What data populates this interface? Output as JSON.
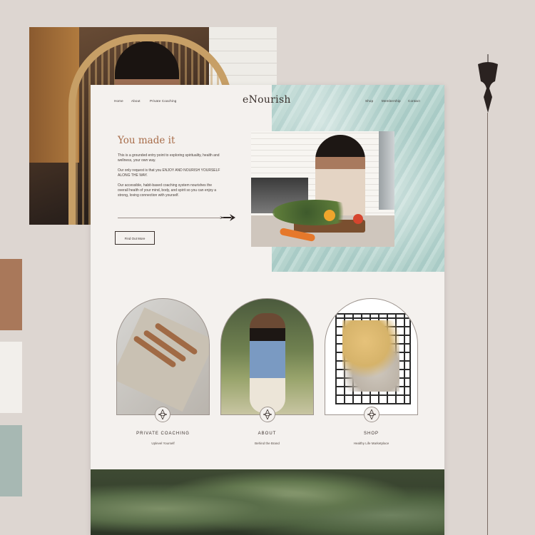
{
  "brand": {
    "logo": "eNourish"
  },
  "nav": {
    "left": [
      "Home",
      "About",
      "Private Coaching"
    ],
    "right": [
      "Shop",
      "Membership",
      "Contact"
    ]
  },
  "intro": {
    "heading": "You made it",
    "paragraphs": [
      "This is a grounded entry point to exploring spirituality, health and wellness, your own way.",
      "Our only request is that you ENJOY AND NOURISH YOURSELF ALONG THE WAY.",
      "Our accessible, habit-based coaching system nourishes the overall health of your mind, body, and spirit so you can enjoy a strong, loving connection with yourself."
    ],
    "cta": "Find Out More"
  },
  "cards": [
    {
      "title": "PRIVATE COACHING",
      "subtitle": "Uplevel Yourself"
    },
    {
      "title": "ABOUT",
      "subtitle": "Behind the Brand"
    },
    {
      "title": "SHOP",
      "subtitle": "Healthy Life Marketplace"
    }
  ],
  "palette": {
    "swatches": [
      "#a9785a",
      "#f2efeb",
      "#a7b8b3"
    ],
    "accent": "#a86d4a"
  },
  "icons": [
    "ornament-icon",
    "arrow-icon",
    "diamond-icon"
  ]
}
